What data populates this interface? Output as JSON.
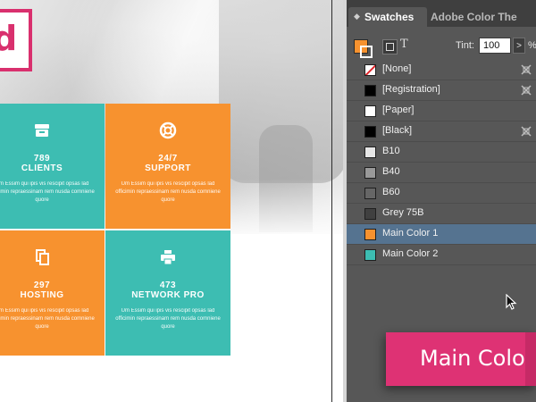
{
  "document": {
    "logo_letter": "d",
    "tiles": [
      {
        "number": "789",
        "label": "CLIENTS",
        "icon": "archive-box-icon",
        "desc": "Um Essim qui ipis vis rescipit opsas lad officimin repraessinam rem nusda comniene quore",
        "color": "#3dbdb2"
      },
      {
        "number": "24/7",
        "label": "SUPPORT",
        "icon": "lifebuoy-icon",
        "desc": "Um Essim qui ipis vis rescipit opsas lad officimin repraessinam rem nusda comniene quore",
        "color": "#f7922f"
      },
      {
        "number": "297",
        "label": "HOSTING",
        "icon": "copy-files-icon",
        "desc": "Um Essim qui ipis vis rescipit opsas lad officimin repraessinam rem nusda comniene quore",
        "color": "#f7922f"
      },
      {
        "number": "473",
        "label": "NETWORK PRO",
        "icon": "printer-icon",
        "desc": "Um Essim qui ipis vis rescipit opsas lad officimin repraessinam rem nusda comniene quore",
        "color": "#3dbdb2"
      }
    ]
  },
  "panel": {
    "tabs": [
      {
        "label": "Swatches",
        "active": true
      },
      {
        "label": "Adobe Color The",
        "active": false
      }
    ],
    "tint_label": "Tint:",
    "tint_value": "100",
    "tint_arrow": ">",
    "tint_unit": "%",
    "fill_color": "#f7922f",
    "swatches": [
      {
        "name": "[None]",
        "color": "none",
        "locked": true
      },
      {
        "name": "[Registration]",
        "color": "#000000",
        "locked": true
      },
      {
        "name": "[Paper]",
        "color": "#ffffff",
        "locked": false
      },
      {
        "name": "[Black]",
        "color": "#000000",
        "locked": true
      },
      {
        "name": "B10",
        "color": "#e6e6e6",
        "locked": false
      },
      {
        "name": "B40",
        "color": "#999999",
        "locked": false
      },
      {
        "name": "B60",
        "color": "#666666",
        "locked": false
      },
      {
        "name": "Grey 75B",
        "color": "#404040",
        "locked": false
      },
      {
        "name": "Main Color 1",
        "color": "#f7922f",
        "locked": false,
        "selected": true
      },
      {
        "name": "Main Color 2",
        "color": "#3dbdb2",
        "locked": false
      }
    ]
  },
  "tooltip": {
    "text": "Main Color",
    "color": "#de3274"
  }
}
